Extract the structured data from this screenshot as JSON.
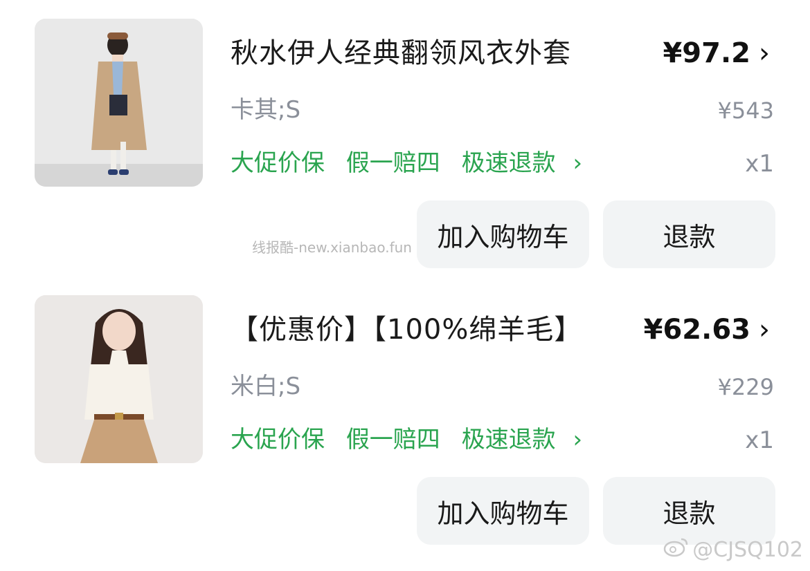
{
  "orders": [
    {
      "title": "秋水伊人经典翻领风衣外套",
      "price": "¥97.2",
      "price_arrow": "›",
      "sku": "卡其;S",
      "original_price": "¥543",
      "guarantees": [
        "大促价保",
        "假一赔四",
        "极速退款"
      ],
      "guarantee_arrow": "›",
      "quantity": "x1",
      "add_to_cart_label": "加入购物车",
      "refund_label": "退款",
      "image_icon": "trench-coat-model-photo"
    },
    {
      "title": "【优惠价】【100%绵羊毛】",
      "price": "¥62.63",
      "price_arrow": "›",
      "sku": "米白;S",
      "original_price": "¥229",
      "guarantees": [
        "大促价保",
        "假一赔四",
        "极速退款"
      ],
      "guarantee_arrow": "›",
      "quantity": "x1",
      "add_to_cart_label": "加入购物车",
      "refund_label": "退款",
      "image_icon": "wool-sweater-model-photo"
    }
  ],
  "watermarks": {
    "middle": "线报酷-new.xianbao.fun",
    "corner": "@CJSQ102"
  },
  "colors": {
    "guarantee_green": "#2aa44f",
    "muted_gray": "#8a8f99",
    "button_bg": "#f2f4f5"
  }
}
